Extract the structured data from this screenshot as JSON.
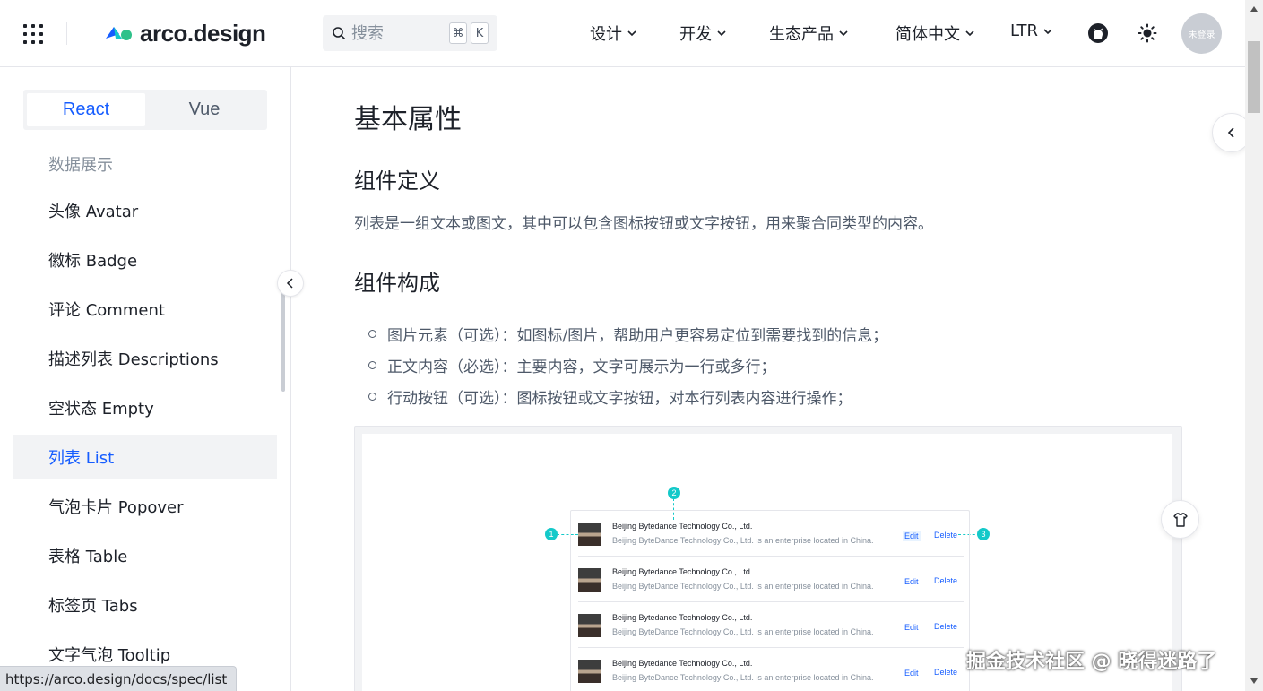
{
  "header": {
    "logo_text": "arco.design",
    "search_placeholder": "搜索",
    "shortcut_keys": [
      "⌘",
      "K"
    ],
    "nav": [
      {
        "label": "设计"
      },
      {
        "label": "开发"
      },
      {
        "label": "生态产品"
      },
      {
        "label": "简体中文"
      },
      {
        "label": "LTR"
      }
    ],
    "avatar_label": "未登录",
    "icons": [
      "app-grid-icon",
      "github-icon",
      "sun-icon"
    ]
  },
  "sidebar": {
    "frameworks": [
      {
        "label": "React",
        "active": true
      },
      {
        "label": "Vue",
        "active": false
      }
    ],
    "group_label": "数据展示",
    "items": [
      {
        "label": "头像 Avatar"
      },
      {
        "label": "徽标 Badge"
      },
      {
        "label": "评论 Comment"
      },
      {
        "label": "描述列表 Descriptions"
      },
      {
        "label": "空状态 Empty"
      },
      {
        "label": "列表 List",
        "active": true
      },
      {
        "label": "气泡卡片 Popover"
      },
      {
        "label": "表格 Table"
      },
      {
        "label": "标签页 Tabs"
      },
      {
        "label": "文字气泡 Tooltip"
      }
    ]
  },
  "main": {
    "title": "基本属性",
    "definition_heading": "组件定义",
    "definition_text": "列表是一组文本或图文，其中可以包含图标按钮或文字按钮，用来聚合同类型的内容。",
    "composition_heading": "组件构成",
    "composition_items": [
      "图片元素（可选）：如图标/图片，帮助用户更容易定位到需要找到的信息；",
      "正文内容（必选）：主要内容，文字可展示为一行或多行；",
      "行动按钮（可选）：图标按钮或文字按钮，对本行列表内容进行操作；"
    ],
    "demo": {
      "markers": [
        "1",
        "2",
        "3"
      ],
      "rows": [
        {
          "title": "Beijing Bytedance Technology Co., Ltd.",
          "description": "Beijing ByteDance Technology Co., Ltd. is an enterprise located in China.",
          "edit": "Edit",
          "delete": "Delete"
        },
        {
          "title": "Beijing Bytedance Technology Co., Ltd.",
          "description": "Beijing ByteDance Technology Co., Ltd. is an enterprise located in China.",
          "edit": "Edit",
          "delete": "Delete"
        },
        {
          "title": "Beijing Bytedance Technology Co., Ltd.",
          "description": "Beijing ByteDance Technology Co., Ltd. is an enterprise located in China.",
          "edit": "Edit",
          "delete": "Delete"
        },
        {
          "title": "Beijing Bytedance Technology Co., Ltd.",
          "description": "Beijing ByteDance Technology Co., Ltd. is an enterprise located in China.",
          "edit": "Edit",
          "delete": "Delete"
        }
      ]
    }
  },
  "status_url": "https://arco.design/docs/spec/list",
  "watermark": "掘金技术社区 @ 晓得迷路了",
  "colors": {
    "primary": "#165dff",
    "marker": "#14c9c9",
    "text": "#1d2129",
    "secondary_text": "#4e5969",
    "muted": "#86909c"
  }
}
